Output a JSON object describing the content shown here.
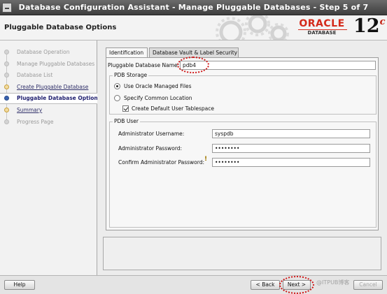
{
  "window": {
    "title": "Database Configuration Assistant - Manage Pluggable Databases - Step 5 of 7"
  },
  "header": {
    "page_title": "Pluggable Database Options",
    "logo_oracle": "ORACLE",
    "logo_database": "DATABASE",
    "logo_version": "12",
    "logo_version_sup": "c"
  },
  "sidebar": {
    "steps": [
      {
        "label": "Database Operation",
        "state": "done"
      },
      {
        "label": "Manage Pluggable Databases",
        "state": "done"
      },
      {
        "label": "Database List",
        "state": "done"
      },
      {
        "label": "Create Pluggable Database",
        "state": "link"
      },
      {
        "label": "Pluggable Database Options",
        "state": "active"
      },
      {
        "label": "Summary",
        "state": "link"
      },
      {
        "label": "Progress Page",
        "state": "pending"
      }
    ]
  },
  "tabs": [
    {
      "label": "Identification",
      "active": true
    },
    {
      "label": "Database Vault & Label Security",
      "active": false
    }
  ],
  "form": {
    "pdb_name_label": "Pluggable Database Name:",
    "pdb_name_value": "pdb4",
    "storage_title": "PDB Storage",
    "use_omf_label": "Use Oracle Managed Files",
    "specify_location_label": "Specify Common Location",
    "create_tablespace_label": "Create Default User Tablespace",
    "user_title": "PDB User",
    "admin_user_label": "Administrator Username:",
    "admin_user_value": "syspdb",
    "admin_pass_label": "Administrator Password:",
    "admin_pass_value": "••••••••",
    "confirm_pass_label": "Confirm Administrator Password:",
    "confirm_pass_value": "••••••••"
  },
  "buttons": {
    "help": "Help",
    "back": "< Back",
    "next": "Next >",
    "cancel": "Cancel"
  },
  "watermark": "@ITPUB博客"
}
